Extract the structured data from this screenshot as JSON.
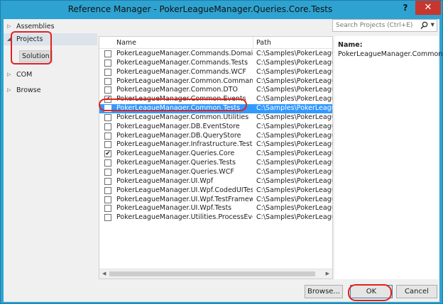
{
  "window": {
    "title": "Reference Manager - PokerLeagueManager.Queries.Core.Tests",
    "help_label": "?",
    "close_label": "✕"
  },
  "nav": {
    "items": [
      {
        "label": "Assemblies"
      },
      {
        "label": "Projects"
      },
      {
        "label": "COM"
      },
      {
        "label": "Browse"
      }
    ],
    "solution_label": "Solution"
  },
  "search": {
    "placeholder": "Search Projects (Ctrl+E)"
  },
  "list": {
    "columns": {
      "name": "Name",
      "path": "Path"
    },
    "rows": [
      {
        "name": "PokerLeagueManager.Commands.Domain",
        "path": "C:\\Samples\\PokerLeague",
        "checked": false
      },
      {
        "name": "PokerLeagueManager.Commands.Tests",
        "path": "C:\\Samples\\PokerLeague",
        "checked": false
      },
      {
        "name": "PokerLeagueManager.Commands.WCF",
        "path": "C:\\Samples\\PokerLeague",
        "checked": false
      },
      {
        "name": "PokerLeagueManager.Common.Commands",
        "path": "C:\\Samples\\PokerLeague",
        "checked": false
      },
      {
        "name": "PokerLeagueManager.Common.DTO",
        "path": "C:\\Samples\\PokerLeague",
        "checked": false
      },
      {
        "name": "PokerLeagueManager.Common.Events",
        "path": "C:\\Samples\\PokerLeague",
        "checked": true
      },
      {
        "name": "PokerLeagueManager.Common.Tests",
        "path": "C:\\Samples\\PokerLeague",
        "checked": true,
        "selected": true
      },
      {
        "name": "PokerLeagueManager.Common.Utilities",
        "path": "C:\\Samples\\PokerLeague",
        "checked": false
      },
      {
        "name": "PokerLeagueManager.DB.EventStore",
        "path": "C:\\Samples\\PokerLeague",
        "checked": false
      },
      {
        "name": "PokerLeagueManager.DB.QueryStore",
        "path": "C:\\Samples\\PokerLeague",
        "checked": false
      },
      {
        "name": "PokerLeagueManager.Infrastructure.Tests",
        "path": "C:\\Samples\\PokerLeague",
        "checked": false
      },
      {
        "name": "PokerLeagueManager.Queries.Core",
        "path": "C:\\Samples\\PokerLeague",
        "checked": true
      },
      {
        "name": "PokerLeagueManager.Queries.Tests",
        "path": "C:\\Samples\\PokerLeague",
        "checked": false
      },
      {
        "name": "PokerLeagueManager.Queries.WCF",
        "path": "C:\\Samples\\PokerLeague",
        "checked": false
      },
      {
        "name": "PokerLeagueManager.UI.Wpf",
        "path": "C:\\Samples\\PokerLeague",
        "checked": false
      },
      {
        "name": "PokerLeagueManager.UI.Wpf.CodedUITests",
        "path": "C:\\Samples\\PokerLeague",
        "checked": false
      },
      {
        "name": "PokerLeagueManager.UI.Wpf.TestFramework",
        "path": "C:\\Samples\\PokerLeague",
        "checked": false
      },
      {
        "name": "PokerLeagueManager.UI.Wpf.Tests",
        "path": "C:\\Samples\\PokerLeague",
        "checked": false
      },
      {
        "name": "PokerLeagueManager.Utilities.ProcessEvents",
        "path": "C:\\Samples\\PokerLeague",
        "checked": false
      }
    ]
  },
  "detail": {
    "name_label": "Name:",
    "name_value": "PokerLeagueManager.Common.Tests"
  },
  "buttons": {
    "browse": "Browse...",
    "ok": "OK",
    "cancel": "Cancel"
  },
  "colors": {
    "titlebar": "#2ea3d1",
    "selection": "#3399ff",
    "callout": "#e0221e",
    "close": "#c7372f"
  },
  "icons": {
    "search": "search-icon",
    "check": "✔",
    "close": "close-icon",
    "expand": "expand-arrow-icon"
  }
}
